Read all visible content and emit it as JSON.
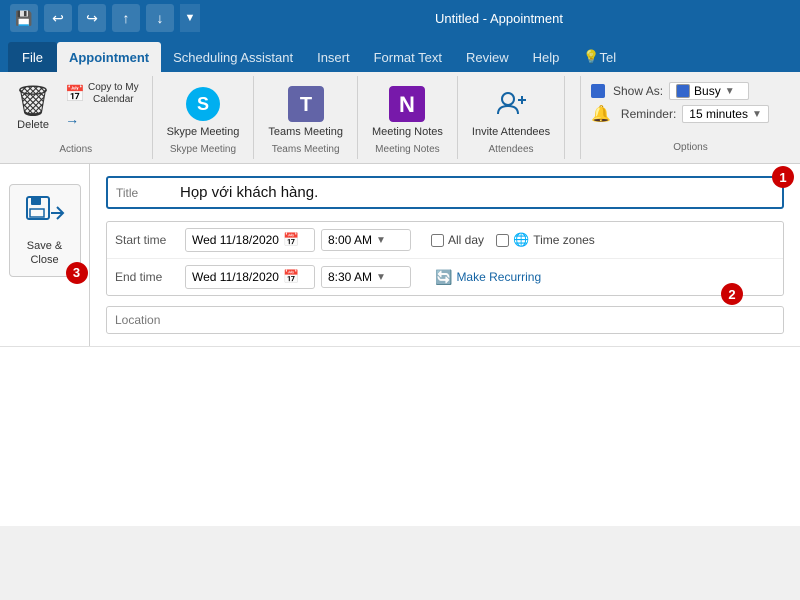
{
  "titleBar": {
    "title": "Untitled - Appointment",
    "controls": [
      "save-icon",
      "undo-icon",
      "redo-icon",
      "up-icon",
      "down-icon"
    ]
  },
  "ribbonTabs": {
    "tabs": [
      {
        "id": "file",
        "label": "File",
        "active": false
      },
      {
        "id": "appointment",
        "label": "Appointment",
        "active": true
      },
      {
        "id": "scheduling",
        "label": "Scheduling Assistant",
        "active": false
      },
      {
        "id": "insert",
        "label": "Insert",
        "active": false
      },
      {
        "id": "formattext",
        "label": "Format Text",
        "active": false
      },
      {
        "id": "review",
        "label": "Review",
        "active": false
      },
      {
        "id": "help",
        "label": "Help",
        "active": false
      },
      {
        "id": "tell",
        "label": "Tel",
        "active": false
      }
    ]
  },
  "ribbon": {
    "groups": {
      "actions": {
        "label": "Actions",
        "delete": "Delete",
        "copyToCalendar": "Copy to My\nCalendar"
      },
      "skype": {
        "label": "Skype Meeting",
        "button": "Skype\nMeeting"
      },
      "teams": {
        "label": "Teams Meeting",
        "button": "Teams\nMeeting"
      },
      "meetingNotes": {
        "label": "Meeting Notes",
        "button": "Meeting\nNotes"
      },
      "attendees": {
        "label": "Attendees",
        "button": "Invite\nAttendees"
      },
      "options": {
        "label": "Options",
        "showAs": "Show As:",
        "showAsValue": "Busy",
        "showAsColor": "#3366cc",
        "reminder": "Reminder:",
        "reminderValue": "15 minutes"
      }
    }
  },
  "saveClose": {
    "label": "Save &\nClose",
    "badge": "3"
  },
  "form": {
    "titleLabel": "Title",
    "titleValue": "Họp với khách hàng.",
    "startTimeLabel": "Start time",
    "startDate": "Wed 11/18/2020",
    "startTime": "8:00 AM",
    "endTimeLabel": "End time",
    "endDate": "Wed 11/18/2020",
    "endTime": "8:30 AM",
    "allDayLabel": "All day",
    "timeZonesLabel": "Time zones",
    "makeRecurring": "Make Recurring",
    "locationLabel": "Location",
    "locationValue": "",
    "badges": {
      "title": "1",
      "endTime": "2",
      "saveClose": "3"
    }
  }
}
